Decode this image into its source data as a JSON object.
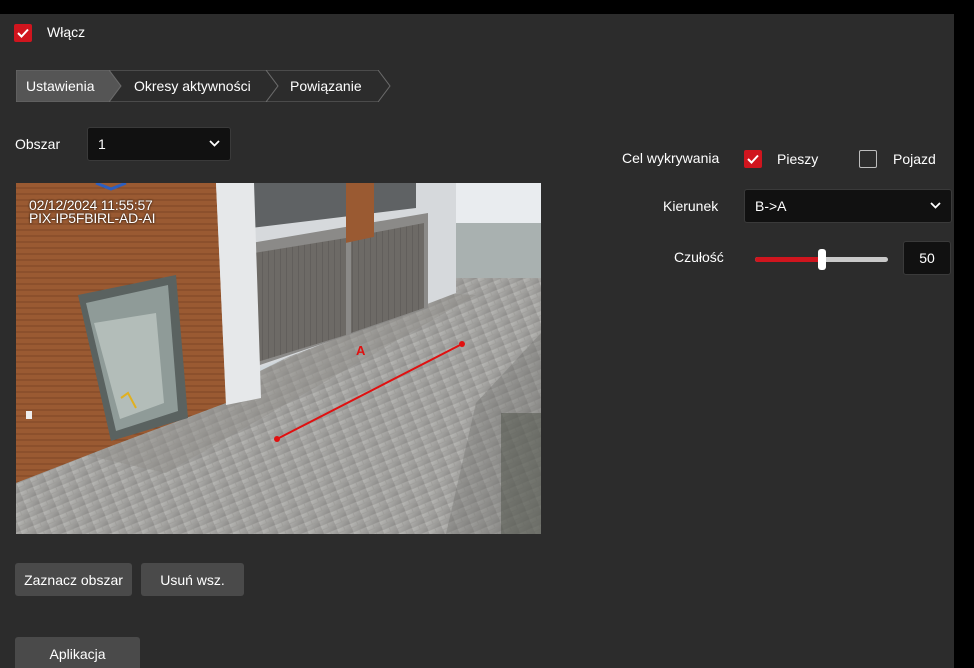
{
  "enable": {
    "label": "Włącz",
    "checked": true
  },
  "tabs": [
    {
      "label": "Ustawienia",
      "active": true
    },
    {
      "label": "Okresy aktywności",
      "active": false
    },
    {
      "label": "Powiązanie",
      "active": false
    }
  ],
  "area": {
    "label": "Obszar",
    "value": "1"
  },
  "video": {
    "timestamp": "02/12/2024  11:55:57",
    "camera_name": "PIX-IP5FBIRL-AD-AI",
    "line_label": "A"
  },
  "buttons": {
    "mark_area": "Zaznacz obszar",
    "clear_all": "Usuń wsz.",
    "apply": "Aplikacja"
  },
  "detection_target": {
    "label": "Cel wykrywania",
    "pedestrian": {
      "label": "Pieszy",
      "checked": true
    },
    "vehicle": {
      "label": "Pojazd",
      "checked": false
    }
  },
  "direction": {
    "label": "Kierunek",
    "value": "B->A"
  },
  "sensitivity": {
    "label": "Czułość",
    "value": "50",
    "level": 0.5
  },
  "colors": {
    "accent": "#d0151e",
    "panel": "#2c2c2c",
    "tab_active": "#555555"
  }
}
